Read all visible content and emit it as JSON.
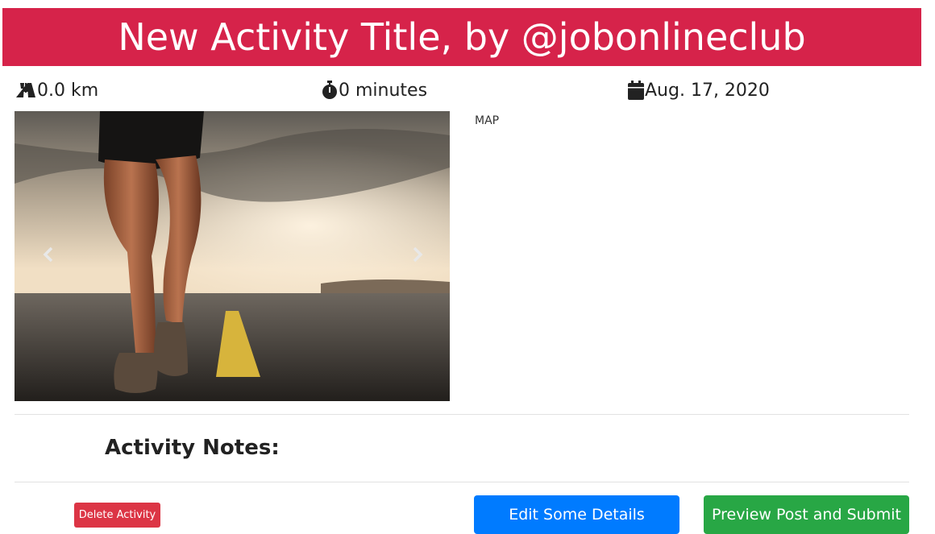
{
  "activity": {
    "title": "New Activity Title, by @jobonlineclub",
    "distance": "0.0 km",
    "duration": "0 minutes",
    "date": "Aug. 17, 2020"
  },
  "map": {
    "label": "MAP"
  },
  "notes": {
    "heading": "Activity Notes:"
  },
  "buttons": {
    "delete": "Delete Activity",
    "edit": "Edit Some Details",
    "submit": "Preview Post and Submit"
  },
  "icons": {
    "distance": "road-icon",
    "duration": "stopwatch-icon",
    "date": "calendar-icon",
    "prev": "chevron-left-icon",
    "next": "chevron-right-icon"
  },
  "colors": {
    "title_bar": "#d6234a",
    "delete": "#dc3545",
    "edit": "#007bff",
    "submit": "#28a745"
  }
}
